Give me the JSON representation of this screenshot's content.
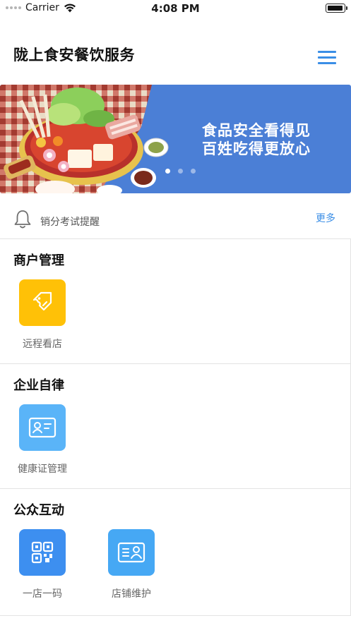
{
  "status_bar": {
    "carrier": "Carrier",
    "time": "4:08 PM"
  },
  "header": {
    "title": "陇上食安餐饮服务",
    "menu_icon": "hamburger-menu-icon"
  },
  "banner": {
    "line1": "食品安全看得见",
    "line2": "百姓吃得更放心",
    "background_color": "#4b7fd6",
    "slide_count": 3,
    "active_slide": 1
  },
  "notice": {
    "icon": "bell-icon",
    "text": "销分考试提醒",
    "more_label": "更多",
    "accent_color": "#3a8ee6"
  },
  "sections": [
    {
      "title": "商户管理",
      "items": [
        {
          "label": "远程看店",
          "icon": "store-tag-icon",
          "color": "#ffc107"
        }
      ]
    },
    {
      "title": "企业自律",
      "items": [
        {
          "label": "健康证管理",
          "icon": "id-card-icon",
          "color": "#5ab4f8"
        }
      ]
    },
    {
      "title": "公众互动",
      "items": [
        {
          "label": "一店一码",
          "icon": "qr-code-icon",
          "color": "#3d8ff0"
        },
        {
          "label": "店铺维护",
          "icon": "profile-card-icon",
          "color": "#46a8f4"
        }
      ]
    }
  ]
}
